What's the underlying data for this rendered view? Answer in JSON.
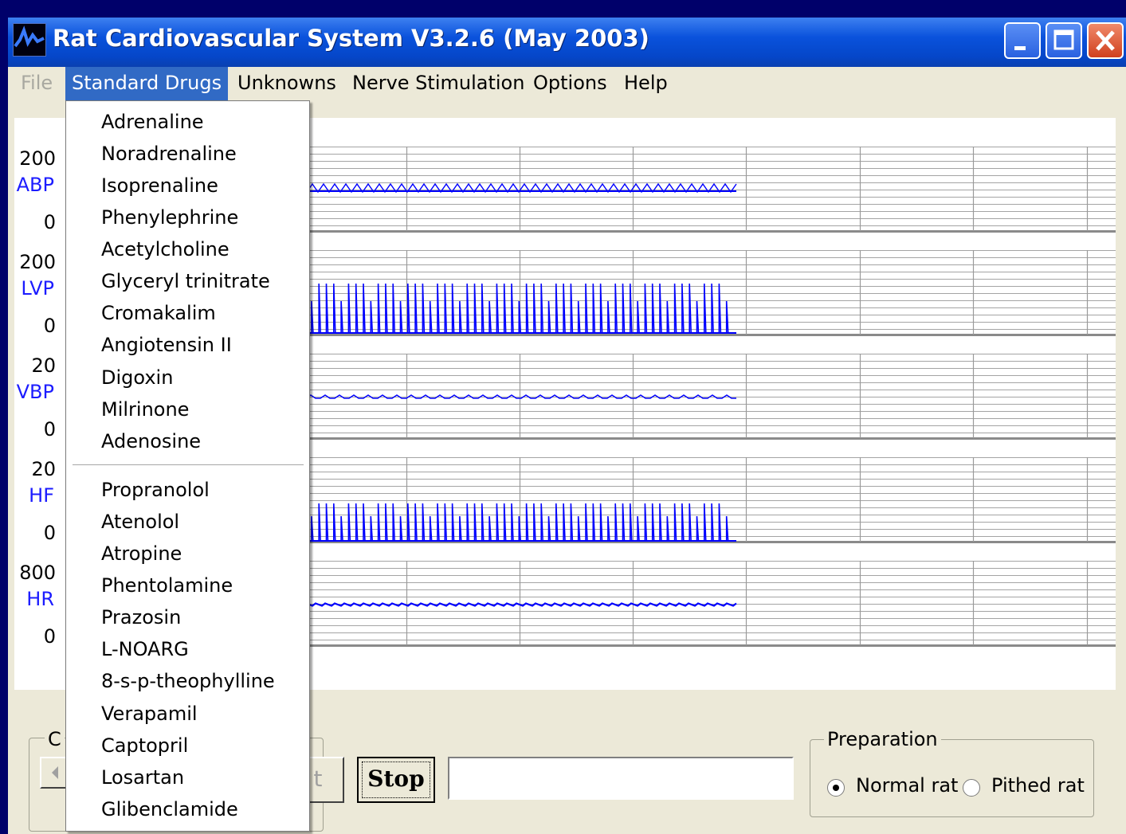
{
  "window": {
    "title": "Rat Cardiovascular System V3.2.6 (May 2003)"
  },
  "menubar": {
    "items": [
      {
        "label": "File",
        "state": "disabled"
      },
      {
        "label": "Standard Drugs",
        "state": "active"
      },
      {
        "label": "Unknowns"
      },
      {
        "label": "Nerve Stimulation"
      },
      {
        "label": "Options"
      },
      {
        "label": "Help"
      }
    ]
  },
  "dropdown": {
    "group1": [
      "Adrenaline",
      "Noradrenaline",
      "Isoprenaline",
      "Phenylephrine",
      "Acetylcholine",
      "Glyceryl trinitrate",
      "Cromakalim",
      "Angiotensin II",
      "Digoxin",
      "Milrinone",
      "Adenosine"
    ],
    "group2": [
      "Propranolol",
      "Atenolol",
      "Atropine",
      "Phentolamine",
      "Prazosin",
      "L-NOARG",
      "8-s-p-theophylline",
      "Verapamil",
      "Captopril",
      "Losartan",
      "Glibenclamide"
    ]
  },
  "channels": [
    {
      "name": "ABP",
      "max": "200",
      "min": "0"
    },
    {
      "name": "LVP",
      "max": "200",
      "min": "0"
    },
    {
      "name": "VBP",
      "max": "20",
      "min": "0"
    },
    {
      "name": "HF",
      "max": "20",
      "min": "0"
    },
    {
      "name": "HR",
      "max": "800",
      "min": "0"
    }
  ],
  "controls": {
    "group_label_partial": "C",
    "start_label_partial": "t",
    "stop_label": "Stop",
    "status_text": "",
    "preparation": {
      "title": "Preparation",
      "options": [
        "Normal rat",
        "Pithed rat"
      ],
      "selected": "Normal rat"
    }
  },
  "colors": {
    "trace": "#0000ff",
    "label": "#1c1cff",
    "menu_highlight": "#316ac5",
    "titlebar": "#0a52dc"
  },
  "icons": [
    "app-icon",
    "minimize-icon",
    "maximize-icon",
    "close-icon",
    "scroll-left-arrow-icon"
  ]
}
